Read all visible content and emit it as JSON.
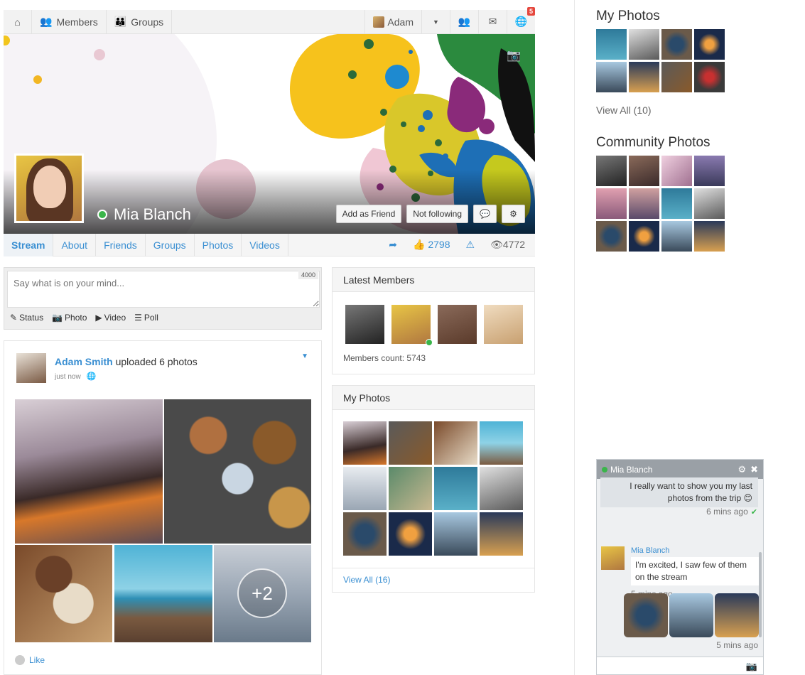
{
  "nav": {
    "members_label": "Members",
    "groups_label": "Groups",
    "user_label": "Adam",
    "notifications_count": "5"
  },
  "profile": {
    "name": "Mia Blanch",
    "add_friend_label": "Add as Friend",
    "following_label": "Not following"
  },
  "tabs": [
    {
      "label": "Stream",
      "active": true
    },
    {
      "label": "About"
    },
    {
      "label": "Friends"
    },
    {
      "label": "Groups"
    },
    {
      "label": "Photos"
    },
    {
      "label": "Videos"
    }
  ],
  "stats": {
    "likes": "2798",
    "views": "4772"
  },
  "composer": {
    "placeholder": "Say what is on your mind...",
    "char_limit": "4000",
    "actions": {
      "status": "Status",
      "photo": "Photo",
      "video": "Video",
      "poll": "Poll"
    }
  },
  "post": {
    "author": "Adam Smith",
    "action": " uploaded 6 photos",
    "time": "just now",
    "more_count": "+2",
    "like_label": "Like"
  },
  "latest_members": {
    "title": "Latest Members",
    "count_label": "Members count: 5743"
  },
  "my_photos_widget": {
    "title": "My Photos",
    "view_all": "View All (16)"
  },
  "right_column": {
    "my_photos_title": "My Photos",
    "my_photos_view_all": "View All (10)",
    "community_title": "Community Photos"
  },
  "chat": {
    "title": "Mia Blanch",
    "my_message": "I really want to show you my last photos from the trip 😊",
    "my_message_time": "6 mins ago",
    "their_name": "Mia Blanch",
    "their_message": "I'm excited, I saw few of them on the stream",
    "their_message_time": "5 mins ago",
    "photos_time": "5 mins ago"
  },
  "colors": {
    "accent": "#3a8fd2",
    "online": "#3ab54a",
    "badge": "#e5473d"
  }
}
